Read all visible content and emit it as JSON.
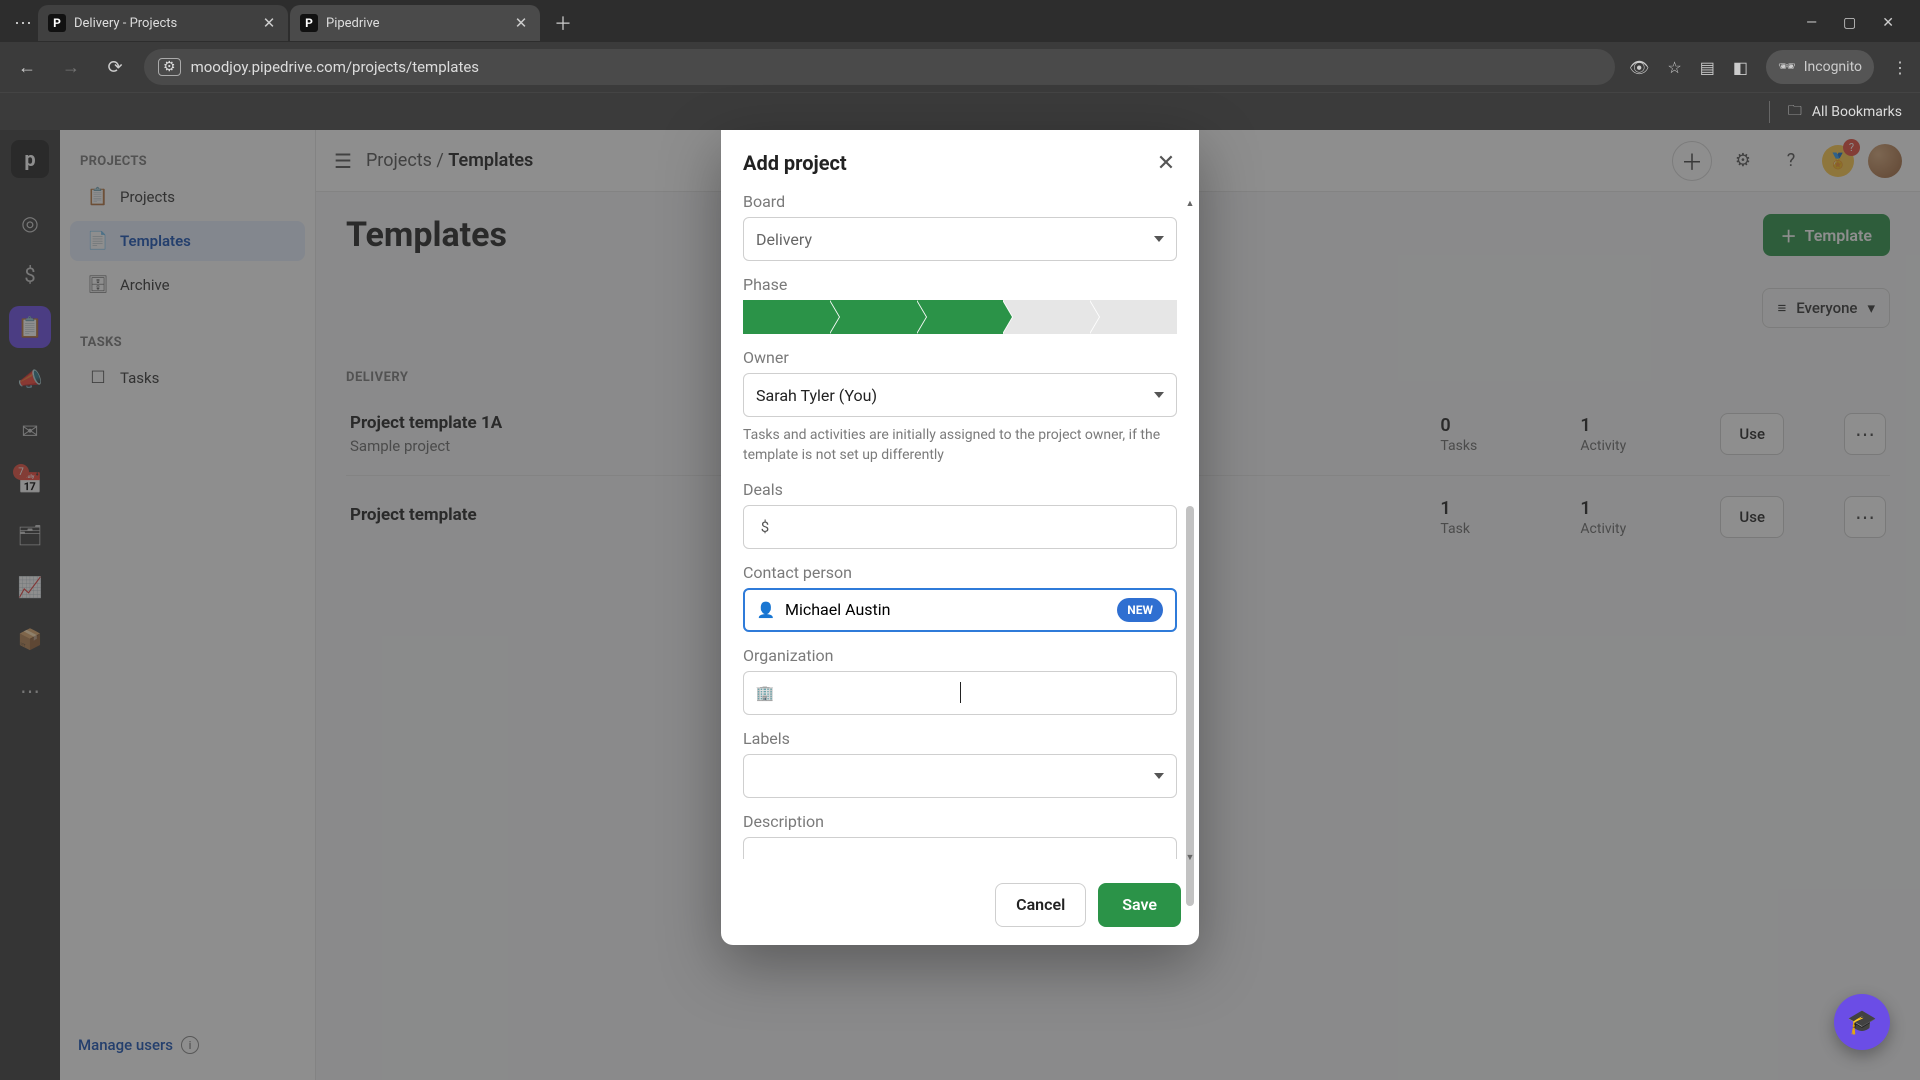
{
  "browser": {
    "tabs": [
      {
        "title": "Delivery - Projects",
        "active": false
      },
      {
        "title": "Pipedrive",
        "active": true
      }
    ],
    "url": "moodjoy.pipedrive.com/projects/templates",
    "incognito_label": "Incognito",
    "all_bookmarks": "All Bookmarks"
  },
  "rail": {
    "badge_count": "7"
  },
  "sidebar": {
    "sections": {
      "projects_label": "PROJECTS",
      "tasks_label": "TASKS"
    },
    "links": {
      "projects": "Projects",
      "templates": "Templates",
      "archive": "Archive",
      "tasks": "Tasks"
    },
    "manage_users": "Manage users"
  },
  "header": {
    "breadcrumb_root": "Projects",
    "breadcrumb_current": "Templates",
    "award_badge": "?"
  },
  "page": {
    "title": "Templates",
    "template_btn": "Template",
    "everyone": "Everyone",
    "section_delivery": "DELIVERY",
    "rows": [
      {
        "title": "Project template 1A",
        "subtitle": "Sample project",
        "stat1_num": "0",
        "stat1_label": "Tasks",
        "stat2_num": "1",
        "stat2_label": "Activity",
        "use": "Use"
      },
      {
        "title": "Project template",
        "subtitle": "",
        "stat1_num": "1",
        "stat1_label": "Task",
        "stat2_num": "1",
        "stat2_label": "Activity",
        "use": "Use"
      }
    ]
  },
  "modal": {
    "title": "Add project",
    "labels": {
      "board": "Board",
      "phase": "Phase",
      "owner": "Owner",
      "deals": "Deals",
      "contact": "Contact person",
      "organization": "Organization",
      "labels": "Labels",
      "description": "Description"
    },
    "values": {
      "board": "Delivery",
      "owner": "Sarah Tyler (You)",
      "contact": "Michael Austin",
      "organization": ""
    },
    "owner_help": "Tasks and activities are initially assigned to the project owner, if the template is not set up differently",
    "new_chip": "NEW",
    "footer": {
      "cancel": "Cancel",
      "save": "Save"
    }
  }
}
